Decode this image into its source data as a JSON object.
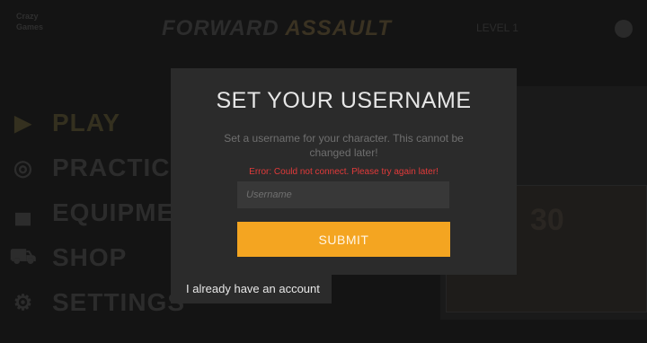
{
  "background": {
    "corner_logo_line1": "Crazy",
    "corner_logo_line2": "Games",
    "game_logo_main": "FORWARD",
    "game_logo_accent": "ASSAULT",
    "level_label": "LEVEL 1",
    "menu_items": [
      {
        "label": "PLAY",
        "icon": "play-icon",
        "glyph": "▶"
      },
      {
        "label": "PRACTICE",
        "icon": "target-icon",
        "glyph": "◎"
      },
      {
        "label": "EQUIPMENT",
        "icon": "gun-icon",
        "glyph": "▄"
      },
      {
        "label": "SHOP",
        "icon": "cart-icon",
        "glyph": "⛟"
      },
      {
        "label": "SETTINGS",
        "icon": "gear-icon",
        "glyph": "⚙"
      }
    ],
    "panel_number": "30"
  },
  "modal": {
    "title": "SET YOUR USERNAME",
    "description": "Set a username for your character. This cannot be changed later!",
    "error": "Error: Could not connect. Please try again later!",
    "input_placeholder": "Username",
    "input_value": "",
    "submit_label": "SUBMIT"
  },
  "account_link": "I already have an account",
  "colors": {
    "accent": "#f4a521",
    "error": "#e23a3a",
    "modal_bg": "#2b2b2b",
    "input_bg": "#383838"
  }
}
